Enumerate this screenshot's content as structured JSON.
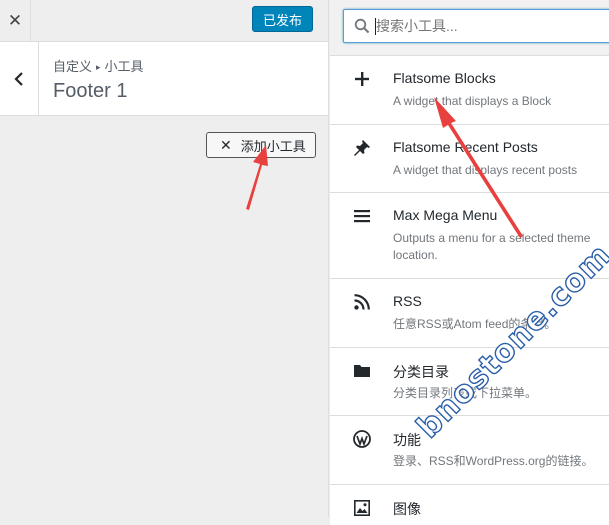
{
  "topbar": {
    "publish_label": "已发布"
  },
  "section": {
    "crumb_parent": "自定义",
    "crumb_child": "小工具",
    "title": "Footer 1"
  },
  "add_widget": {
    "label": "添加小工具"
  },
  "search": {
    "placeholder": "搜索小工具..."
  },
  "widgets": [
    {
      "name": "Flatsome Blocks",
      "desc": "A widget that displays a Block",
      "icon": "plus-icon"
    },
    {
      "name": "Flatsome Recent Posts",
      "desc": "A widget that displays recent posts",
      "icon": "pin-icon"
    },
    {
      "name": "Max Mega Menu",
      "desc": "Outputs a menu for a selected theme location.",
      "icon": "menu-icon"
    },
    {
      "name": "RSS",
      "desc": "任意RSS或Atom feed的条目。",
      "icon": "rss-icon"
    },
    {
      "name": "分类目录",
      "desc": "分类目录列表或下拉菜单。",
      "icon": "folder-icon"
    },
    {
      "name": "功能",
      "desc": "登录、RSS和WordPress.org的链接。",
      "icon": "wordpress-icon"
    },
    {
      "name": "图像",
      "desc": "",
      "icon": "image-icon"
    }
  ],
  "watermark": "bnostone.com",
  "colors": {
    "accent": "#0085ba",
    "arrow": "#e8403f",
    "watermark_stroke": "#2b5fa8"
  }
}
